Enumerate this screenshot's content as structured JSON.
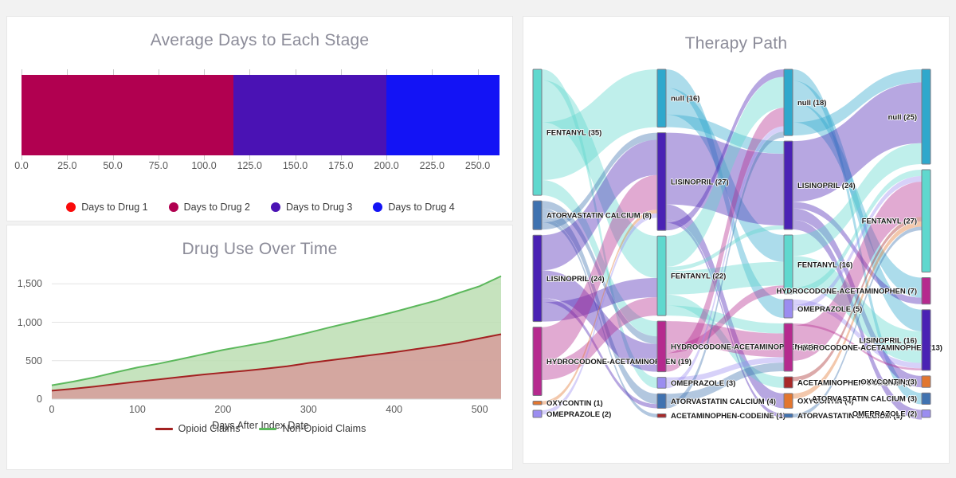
{
  "stage_card": {
    "title": "Average Days to Each Stage",
    "legend": [
      {
        "label": "Days to Drug 1",
        "color": "#fa0a0a"
      },
      {
        "label": "Days to Drug 2",
        "color": "#b10050"
      },
      {
        "label": "Days to Drug 3",
        "color": "#4a12b4"
      },
      {
        "label": "Days to Drug 4",
        "color": "#1313f5"
      }
    ]
  },
  "time_card": {
    "title": "Drug Use Over Time"
  },
  "sankey_card": {
    "title": "Therapy Path"
  },
  "chart_data": [
    {
      "type": "bar",
      "title": "Average Days to Each Stage",
      "orientation": "horizontal",
      "stacked": true,
      "xlabel": "",
      "ylabel": "",
      "xlim": [
        0,
        262
      ],
      "grid": false,
      "legend_position": "bottom",
      "tick_labels": [
        "0.0",
        "25.0",
        "50.0",
        "75.0",
        "100.0",
        "125.0",
        "150.0",
        "175.0",
        "200.0",
        "225.0",
        "250.0"
      ],
      "tick_values": [
        0,
        25,
        50,
        75,
        100,
        125,
        150,
        175,
        200,
        225,
        250
      ],
      "series": [
        {
          "name": "Days to Drug 1",
          "color": "#fa0a0a",
          "start": 0,
          "end": 0,
          "value": 0
        },
        {
          "name": "Days to Drug 2",
          "color": "#b10050",
          "start": 0,
          "end": 116,
          "value": 116
        },
        {
          "name": "Days to Drug 3",
          "color": "#4a12b4",
          "start": 116,
          "end": 200,
          "value": 84
        },
        {
          "name": "Days to Drug 4",
          "color": "#1313f5",
          "start": 200,
          "end": 262,
          "value": 62
        }
      ]
    },
    {
      "type": "area",
      "title": "Drug Use Over Time",
      "xlabel": "Days After Index Date",
      "ylabel": "",
      "xlim": [
        0,
        525
      ],
      "ylim": [
        0,
        1700
      ],
      "grid": true,
      "legend_position": "bottom",
      "ytick_labels": [
        "0",
        "500",
        "1,000",
        "1,500"
      ],
      "ytick_values": [
        0,
        500,
        1000,
        1500
      ],
      "xtick_labels": [
        "0",
        "100",
        "200",
        "300",
        "400",
        "500"
      ],
      "xtick_values": [
        0,
        100,
        200,
        300,
        400,
        500
      ],
      "x": [
        0,
        25,
        50,
        75,
        100,
        125,
        150,
        175,
        200,
        225,
        250,
        275,
        300,
        325,
        350,
        375,
        400,
        425,
        450,
        475,
        500,
        525
      ],
      "series": [
        {
          "name": "Opioid Claims",
          "color": "#a32121",
          "fill": "#d79a9a",
          "values": [
            110,
            135,
            163,
            196,
            228,
            256,
            288,
            318,
            344,
            368,
            396,
            428,
            470,
            505,
            540,
            575,
            610,
            650,
            690,
            735,
            790,
            845
          ]
        },
        {
          "name": "Non-Opioid Claims",
          "color": "#5cb85c",
          "fill": "#b9ddb0",
          "values": [
            180,
            228,
            284,
            350,
            412,
            462,
            520,
            580,
            640,
            690,
            740,
            800,
            865,
            935,
            1000,
            1065,
            1135,
            1210,
            1285,
            1380,
            1470,
            1600
          ]
        }
      ]
    },
    {
      "type": "sankey",
      "title": "Therapy Path",
      "columns": [
        {
          "index": 0,
          "nodes": [
            {
              "label": "FENTANYL (35)",
              "value": 35,
              "color": "#5fd8ce"
            },
            {
              "label": "ATORVASTATIN CALCIUM (8)",
              "value": 8,
              "color": "#3f72b0"
            },
            {
              "label": "LISINOPRIL (24)",
              "value": 24,
              "color": "#4a22b4"
            },
            {
              "label": "HYDROCODONE-ACETAMINOPHEN (19)",
              "value": 19,
              "color": "#b52a8e"
            },
            {
              "label": "OXYCONTIN (1)",
              "value": 1,
              "color": "#e2762f"
            },
            {
              "label": "OMEPRAZOLE (2)",
              "value": 2,
              "color": "#9b8df0"
            }
          ]
        },
        {
          "index": 1,
          "nodes": [
            {
              "label": "null (16)",
              "value": 16,
              "color": "#2fa8cc"
            },
            {
              "label": "LISINOPRIL (27)",
              "value": 27,
              "color": "#4a22b4"
            },
            {
              "label": "FENTANYL (22)",
              "value": 22,
              "color": "#5fd8ce"
            },
            {
              "label": "HYDROCODONE-ACETAMINOPHEN (14)",
              "value": 14,
              "color": "#b52a8e"
            },
            {
              "label": "OMEPRAZOLE (3)",
              "value": 3,
              "color": "#9b8df0"
            },
            {
              "label": "ATORVASTATIN CALCIUM (4)",
              "value": 4,
              "color": "#3f72b0"
            },
            {
              "label": "ACETAMINOPHEN-CODEINE (1)",
              "value": 1,
              "color": "#a82a2a"
            }
          ]
        },
        {
          "index": 2,
          "nodes": [
            {
              "label": "null (18)",
              "value": 18,
              "color": "#2fa8cc"
            },
            {
              "label": "LISINOPRIL (24)",
              "value": 24,
              "color": "#4a22b4"
            },
            {
              "label": "FENTANYL (16)",
              "value": 16,
              "color": "#5fd8ce"
            },
            {
              "label": "OMEPRAZOLE (5)",
              "value": 5,
              "color": "#9b8df0"
            },
            {
              "label": "HYDROCODONE-ACETAMINOPHEN (13)",
              "value": 13,
              "color": "#b52a8e"
            },
            {
              "label": "ACETAMINOPHEN-CODEINE (3)",
              "value": 3,
              "color": "#a82a2a"
            },
            {
              "label": "OXYCONTIN (4)",
              "value": 4,
              "color": "#e2762f"
            },
            {
              "label": "ATORVASTATIN CALCIUM (1)",
              "value": 1,
              "color": "#3f72b0"
            }
          ]
        },
        {
          "index": 3,
          "nodes": [
            {
              "label": "null (25)",
              "value": 25,
              "color": "#2fa8cc"
            },
            {
              "label": "FENTANYL (27)",
              "value": 27,
              "color": "#5fd8ce"
            },
            {
              "label": "HYDROCODONE-ACETAMINOPHEN (7)",
              "value": 7,
              "color": "#b52a8e"
            },
            {
              "label": "LISINOPRIL (16)",
              "value": 16,
              "color": "#4a22b4"
            },
            {
              "label": "OXYCONTIN (3)",
              "value": 3,
              "color": "#e2762f"
            },
            {
              "label": "ATORVASTATIN CALCIUM (3)",
              "value": 3,
              "color": "#3f72b0"
            },
            {
              "label": "OMEPRAZOLE (2)",
              "value": 2,
              "color": "#9b8df0"
            }
          ]
        }
      ]
    }
  ]
}
